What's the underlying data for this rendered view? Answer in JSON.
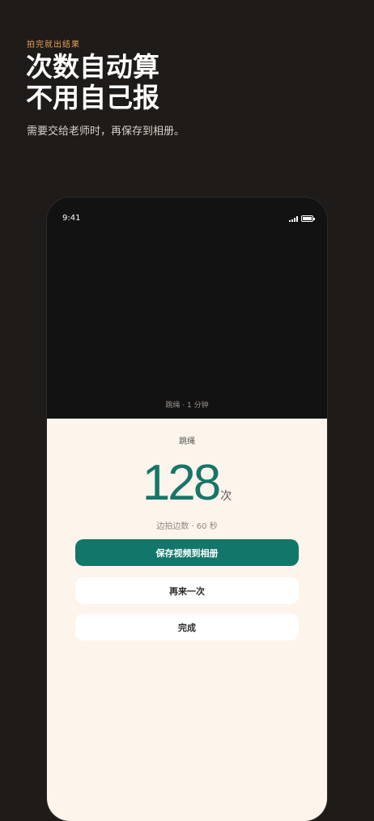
{
  "header": {
    "eyebrow": "拍完就出结果",
    "headline_line1": "次数自动算",
    "headline_line2": "不用自己报",
    "subline": "需要交给老师时，再保存到相册。"
  },
  "phone": {
    "status_time": "9:41",
    "video_caption": "跳绳 · 1 分钟",
    "result": {
      "title": "跳绳",
      "count": "128",
      "unit": "次",
      "meta": "边拍边数 · 60 秒"
    },
    "buttons": {
      "save": "保存视频到相册",
      "again": "再来一次",
      "done": "完成"
    }
  }
}
